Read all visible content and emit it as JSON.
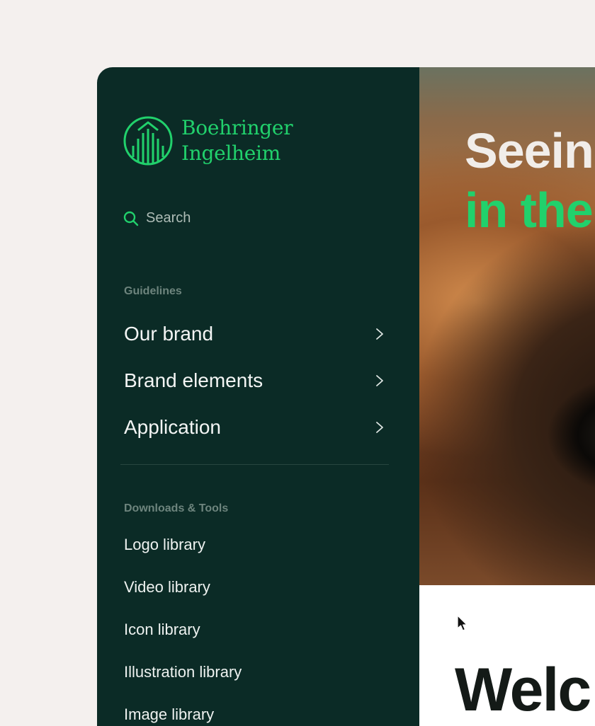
{
  "brand": {
    "line1": "Boehringer",
    "line2": "Ingelheim",
    "color": "#21d16c"
  },
  "search": {
    "label": "Search",
    "icon": "search-icon"
  },
  "guidelines": {
    "heading": "Guidelines",
    "items": [
      {
        "label": "Our brand",
        "icon": "chevron-right-icon"
      },
      {
        "label": "Brand elements",
        "icon": "chevron-right-icon"
      },
      {
        "label": "Application",
        "icon": "chevron-right-icon"
      }
    ]
  },
  "downloads": {
    "heading": "Downloads & Tools",
    "items": [
      {
        "label": "Logo library"
      },
      {
        "label": "Video library"
      },
      {
        "label": "Icon library"
      },
      {
        "label": "Illustration library"
      },
      {
        "label": "Image library"
      }
    ]
  },
  "hero": {
    "line1": "Seein",
    "line2": "in the",
    "accent_color": "#21d16c"
  },
  "content": {
    "welcome": "Welc"
  },
  "colors": {
    "sidebar_bg": "#0b2b26",
    "page_bg": "#f4f0ee"
  }
}
